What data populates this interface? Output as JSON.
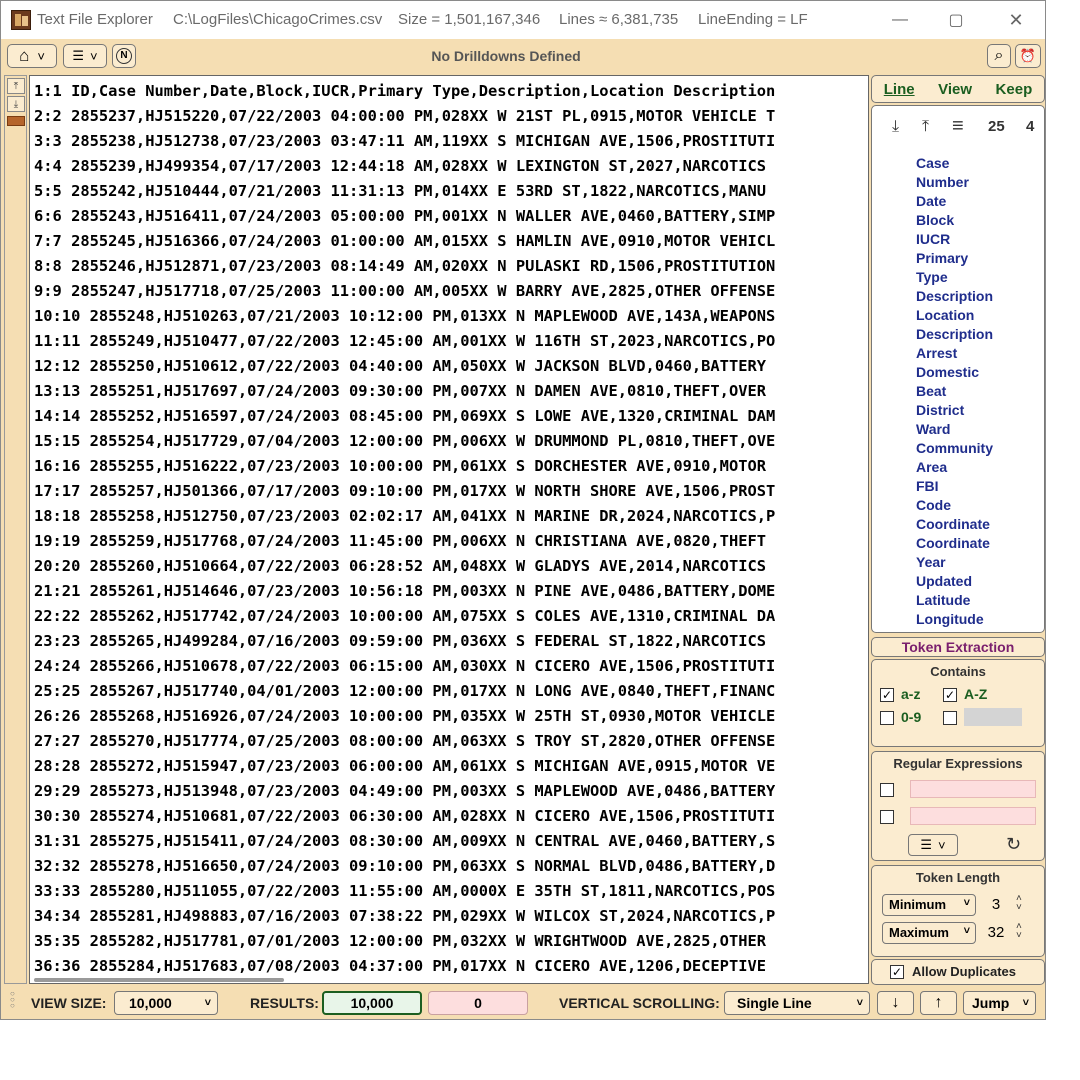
{
  "titlebar": {
    "app_name": "Text File Explorer",
    "file_path": "C:\\LogFiles\\ChicagoCrimes.csv",
    "size": "Size = 1,501,167,346",
    "lines": "Lines ≈ 6,381,735",
    "line_ending": "LineEnding = LF",
    "minimize": "—",
    "maximize": "▢",
    "close": "✕"
  },
  "toolbar": {
    "home_icon": "⌂",
    "list_icon": "☰",
    "chevron": "˅",
    "n_icon": "N",
    "drilldowns": "No Drilldowns Defined",
    "search_icon": "⌕",
    "alarm_icon": "⏰"
  },
  "lines": [
    "1:1 ID,Case Number,Date,Block,IUCR,Primary Type,Description,Location Description",
    "2:2 2855237,HJ515220,07/22/2003 04:00:00 PM,028XX W 21ST PL,0915,MOTOR VEHICLE T",
    "3:3 2855238,HJ512738,07/23/2003 03:47:11 AM,119XX S MICHIGAN AVE,1506,PROSTITUTI",
    "4:4 2855239,HJ499354,07/17/2003 12:44:18 AM,028XX W LEXINGTON ST,2027,NARCOTICS",
    "5:5 2855242,HJ510444,07/21/2003 11:31:13 PM,014XX E 53RD ST,1822,NARCOTICS,MANU",
    "6:6 2855243,HJ516411,07/24/2003 05:00:00 PM,001XX N WALLER AVE,0460,BATTERY,SIMP",
    "7:7 2855245,HJ516366,07/24/2003 01:00:00 AM,015XX S HAMLIN AVE,0910,MOTOR VEHICL",
    "8:8 2855246,HJ512871,07/23/2003 08:14:49 AM,020XX N PULASKI RD,1506,PROSTITUTION",
    "9:9 2855247,HJ517718,07/25/2003 11:00:00 AM,005XX W BARRY AVE,2825,OTHER OFFENSE",
    "10:10 2855248,HJ510263,07/21/2003 10:12:00 PM,013XX N MAPLEWOOD AVE,143A,WEAPONS",
    "11:11 2855249,HJ510477,07/22/2003 12:45:00 AM,001XX W 116TH ST,2023,NARCOTICS,PO",
    "12:12 2855250,HJ510612,07/22/2003 04:40:00 AM,050XX W JACKSON BLVD,0460,BATTERY",
    "13:13 2855251,HJ517697,07/24/2003 09:30:00 PM,007XX N DAMEN AVE,0810,THEFT,OVER",
    "14:14 2855252,HJ516597,07/24/2003 08:45:00 PM,069XX S LOWE AVE,1320,CRIMINAL DAM",
    "15:15 2855254,HJ517729,07/04/2003 12:00:00 PM,006XX W DRUMMOND PL,0810,THEFT,OVE",
    "16:16 2855255,HJ516222,07/23/2003 10:00:00 PM,061XX S DORCHESTER AVE,0910,MOTOR",
    "17:17 2855257,HJ501366,07/17/2003 09:10:00 PM,017XX W NORTH SHORE AVE,1506,PROST",
    "18:18 2855258,HJ512750,07/23/2003 02:02:17 AM,041XX N MARINE DR,2024,NARCOTICS,P",
    "19:19 2855259,HJ517768,07/24/2003 11:45:00 PM,006XX N CHRISTIANA AVE,0820,THEFT",
    "20:20 2855260,HJ510664,07/22/2003 06:28:52 AM,048XX W GLADYS AVE,2014,NARCOTICS",
    "21:21 2855261,HJ514646,07/23/2003 10:56:18 PM,003XX N PINE AVE,0486,BATTERY,DOME",
    "22:22 2855262,HJ517742,07/24/2003 10:00:00 AM,075XX S COLES AVE,1310,CRIMINAL DA",
    "23:23 2855265,HJ499284,07/16/2003 09:59:00 PM,036XX S FEDERAL ST,1822,NARCOTICS",
    "24:24 2855266,HJ510678,07/22/2003 06:15:00 AM,030XX N CICERO AVE,1506,PROSTITUTI",
    "25:25 2855267,HJ517740,04/01/2003 12:00:00 PM,017XX N LONG AVE,0840,THEFT,FINANC",
    "26:26 2855268,HJ516926,07/24/2003 10:00:00 PM,035XX W 25TH ST,0930,MOTOR VEHICLE",
    "27:27 2855270,HJ517774,07/25/2003 08:00:00 AM,063XX S TROY ST,2820,OTHER OFFENSE",
    "28:28 2855272,HJ515947,07/23/2003 06:00:00 AM,061XX S MICHIGAN AVE,0915,MOTOR VE",
    "29:29 2855273,HJ513948,07/23/2003 04:49:00 PM,003XX S MAPLEWOOD AVE,0486,BATTERY",
    "30:30 2855274,HJ510681,07/22/2003 06:30:00 AM,028XX N CICERO AVE,1506,PROSTITUTI",
    "31:31 2855275,HJ515411,07/24/2003 08:30:00 AM,009XX N CENTRAL AVE,0460,BATTERY,S",
    "32:32 2855278,HJ516650,07/24/2003 09:10:00 PM,063XX S NORMAL BLVD,0486,BATTERY,D",
    "33:33 2855280,HJ511055,07/22/2003 11:55:00 AM,0000X E 35TH ST,1811,NARCOTICS,POS",
    "34:34 2855281,HJ498883,07/16/2003 07:38:22 PM,029XX W WILCOX ST,2024,NARCOTICS,P",
    "35:35 2855282,HJ517781,07/01/2003 12:00:00 PM,032XX W WRIGHTWOOD AVE,2825,OTHER",
    "36:36 2855284,HJ517683,07/08/2003 04:37:00 PM,017XX N CICERO AVE,1206,DECEPTIVE"
  ],
  "right": {
    "tabs": [
      "Line",
      "View",
      "Keep"
    ],
    "tools": {
      "down_icon": "⤓",
      "up_icon": "⤒",
      "lines_icon": "≡",
      "count_a": "25",
      "count_b": "4"
    },
    "columns": [
      "Case",
      "Number",
      "Date",
      "Block",
      "IUCR",
      "Primary",
      "Type",
      "Description",
      "Location",
      "Description",
      "Arrest",
      "Domestic",
      "Beat",
      "District",
      "Ward",
      "Community",
      "Area",
      "FBI",
      "Code",
      "Coordinate",
      "Coordinate",
      "Year",
      "Updated",
      "Latitude",
      "Longitude"
    ],
    "token_extraction": "Token Extraction",
    "contains": {
      "title": "Contains",
      "az": "a-z",
      "AZ": "A-Z",
      "digits": "0-9",
      "check_mark": "✓"
    },
    "regex": {
      "title": "Regular Expressions",
      "list_icon": "☰",
      "chevron": "˅",
      "reset_icon": "↻"
    },
    "token_length": {
      "title": "Token Length",
      "min_label": "Minimum",
      "min_value": "3",
      "max_label": "Maximum",
      "max_value": "32",
      "spin_up": "˄",
      "spin_down": "˅",
      "chevron": "˅"
    },
    "allow_duplicates": "Allow Duplicates"
  },
  "statusbar": {
    "view_size_label": "VIEW SIZE:",
    "view_size": "10,000",
    "results_label": "RESULTS:",
    "results": "10,000",
    "results_zero": "0",
    "vscroll_label": "VERTICAL SCROLLING:",
    "vscroll_mode": "Single Line",
    "down_icon": "↓",
    "up_icon": "↑",
    "jump": "Jump",
    "chevron": "˅"
  },
  "colors": {
    "window_bg": "#f5deb3",
    "panel_bg": "#fbecd0",
    "results_border": "#1b5e20",
    "results_bg": "#e8f5e9",
    "zero_bg": "#fddede",
    "column_text": "#1f2d8c",
    "tab_text": "#1b5e20",
    "token_head": "#7a1f6e"
  },
  "icons": [
    "app-icon",
    "home-icon",
    "list-icon",
    "n-circle-icon",
    "search-icon",
    "alarm-icon",
    "arrow-down-icon",
    "arrow-up-icon",
    "lines-icon",
    "reset-icon",
    "grip-icon"
  ]
}
